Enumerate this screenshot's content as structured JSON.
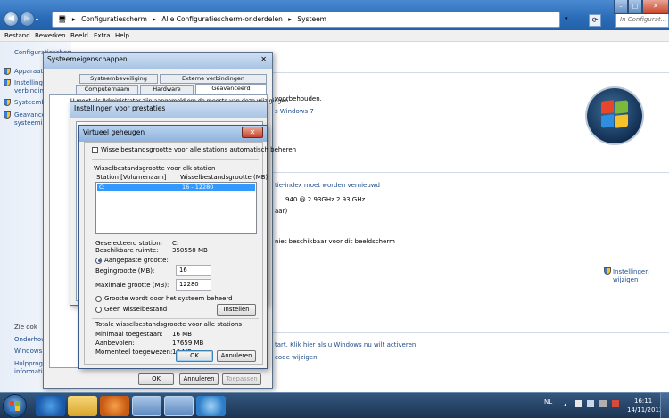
{
  "explorer": {
    "breadcrumb": [
      "Configuratiescherm",
      "Alle Configuratiescherm-onderdelen",
      "Systeem"
    ],
    "search_placeholder": "In Configurat...",
    "menu": [
      "Bestand",
      "Bewerken",
      "Beeld",
      "Extra",
      "Help"
    ]
  },
  "leftpane": {
    "home": "Configuratiescherm",
    "items": [
      "Apparaatbeheer",
      "Instellingen v...",
      "verbindingen",
      "Systeembeveil...",
      "Geavanceerde",
      "systeeminstell..."
    ],
    "see_also": "Zie ook",
    "links": [
      "Onderhoudscentrum",
      "Windows Update",
      "Hulpprogramma's v",
      "informatie over pres"
    ]
  },
  "main": {
    "reserved": "voorbehouden.",
    "win7": "s Windows 7",
    "rating_link": "tie-index moet worden vernieuwd",
    "cpu": "940  @ 2.93GHz   2.93 GHz",
    "bits": "aar)",
    "pen": "niet beschikbaar voor dit beeldscherm",
    "change_settings_1": "Instellingen",
    "change_settings_2": "wijzigen",
    "activation": "tart. Klik hier als u Windows nu wilt activeren.",
    "productkey": "code wijzigen"
  },
  "sysprops": {
    "title": "Systeemeigenschappen",
    "tabs_top": [
      "Systeembeveiliging",
      "Externe verbindingen"
    ],
    "tabs_bottom": [
      "Computernaam",
      "Hardware",
      "Geavanceerd"
    ],
    "line1": "U moet als Administrator zijn aangemeld om de meeste van deze wijzigingen",
    "ok": "OK",
    "cancel": "Annuleren",
    "apply": "Toepassen"
  },
  "perf": {
    "title": "Instellingen voor prestaties"
  },
  "vmem": {
    "title": "Virtueel geheugen",
    "auto_label": "Wisselbestandsgrootte voor alle stations automatisch beheren",
    "per_drive": "Wisselbestandsgrootte voor elk station",
    "col_station": "Station [Volumenaam]",
    "col_size": "Wisselbestandsgrootte (MB)",
    "drive": "C:",
    "drive_size": "16 - 12280",
    "selected_label": "Geselecteerd station:",
    "selected_value": "C:",
    "free_label": "Beschikbare ruimte:",
    "free_value": "350558 MB",
    "custom_label": "Aangepaste grootte:",
    "initial_label": "Begingrootte (MB):",
    "initial_value": "16",
    "max_label": "Maximale grootte (MB):",
    "max_value": "12280",
    "system_label": "Grootte wordt door het systeem beheerd",
    "none_label": "Geen wisselbestand",
    "set_button": "Instellen",
    "total_header": "Totale wisselbestandsgrootte voor alle stations",
    "min_label": "Minimaal toegestaan:",
    "min_value": "16 MB",
    "rec_label": "Aanbevolen:",
    "rec_value": "17659 MB",
    "cur_label": "Momenteel toegewezen:",
    "cur_value": "16 MB",
    "ok": "OK",
    "cancel": "Annuleren"
  },
  "taskbar": {
    "lang": "NL",
    "time": "16:11",
    "date": "14/11/2013"
  }
}
